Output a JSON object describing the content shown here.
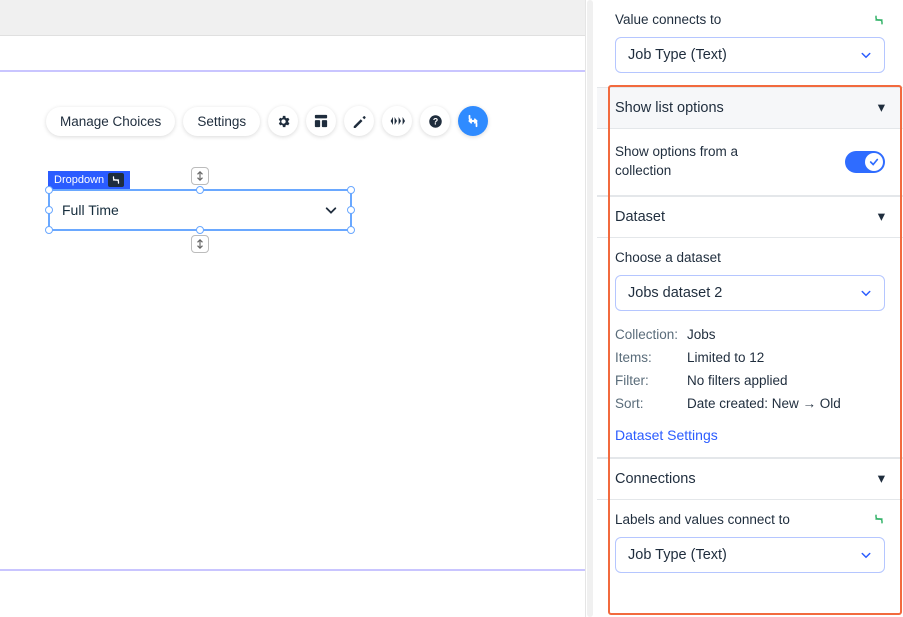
{
  "canvas": {
    "element_tag": "Dropdown",
    "dropdown_value": "Full Time"
  },
  "toolbar": {
    "manage_choices": "Manage Choices",
    "settings": "Settings"
  },
  "panel": {
    "value_connect_label": "Value connects to",
    "value_connect_value": "Job Type (Text)",
    "show_list_options": "Show list options",
    "show_options_from_collection": "Show options from a collection",
    "dataset_heading": "Dataset",
    "choose_dataset_label": "Choose a dataset",
    "dataset_value": "Jobs dataset 2",
    "meta": {
      "collection_k": "Collection:",
      "collection_v": "Jobs",
      "items_k": "Items:",
      "items_v": "Limited to 12",
      "filter_k": "Filter:",
      "filter_v": "No filters applied",
      "sort_k": "Sort:",
      "sort_v": "Date created: New → Old"
    },
    "dataset_settings": "Dataset Settings",
    "connections_heading": "Connections",
    "labels_values_label": "Labels and values connect to",
    "labels_values_value": "Job Type (Text)"
  }
}
